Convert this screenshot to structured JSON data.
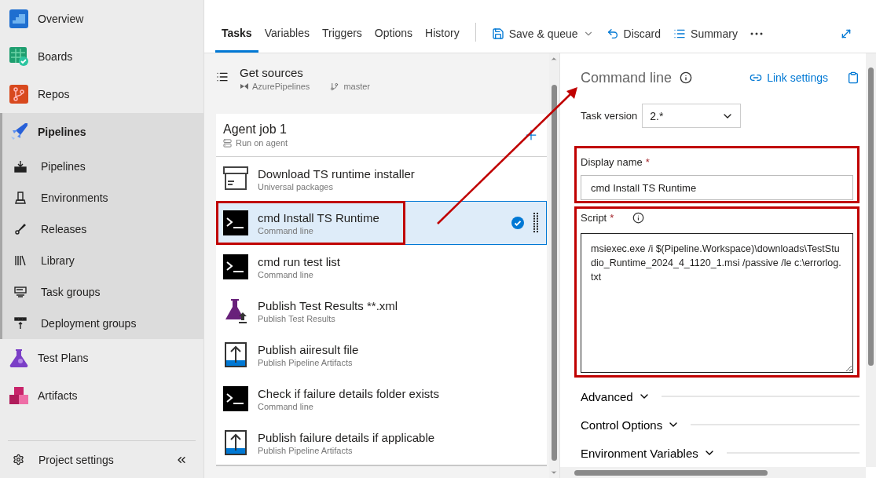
{
  "sidebar": {
    "items": [
      {
        "label": "Overview",
        "selected": false
      },
      {
        "label": "Boards",
        "selected": false
      },
      {
        "label": "Repos",
        "selected": false
      },
      {
        "label": "Pipelines",
        "selected": true,
        "expanded": true,
        "children": [
          {
            "label": "Pipelines"
          },
          {
            "label": "Environments"
          },
          {
            "label": "Releases"
          },
          {
            "label": "Library"
          },
          {
            "label": "Task groups"
          },
          {
            "label": "Deployment groups"
          }
        ]
      },
      {
        "label": "Test Plans",
        "selected": false
      },
      {
        "label": "Artifacts",
        "selected": false
      }
    ],
    "footer": {
      "label": "Project settings"
    }
  },
  "tabs": [
    {
      "label": "Tasks",
      "selected": true
    },
    {
      "label": "Variables",
      "selected": false
    },
    {
      "label": "Triggers",
      "selected": false
    },
    {
      "label": "Options",
      "selected": false
    },
    {
      "label": "History",
      "selected": false
    }
  ],
  "toolbar": [
    {
      "label": "Save & queue",
      "kind": "save"
    },
    {
      "label": "Discard",
      "kind": "discard"
    },
    {
      "label": "Summary",
      "kind": "summary"
    }
  ],
  "get_sources": {
    "title": "Get sources",
    "repo": "AzurePipelines",
    "branch": "master"
  },
  "agent_job": {
    "title": "Agent job 1",
    "subtitle": "Run on agent"
  },
  "tasks": [
    {
      "name": "Download TS runtime installer",
      "type": "Universal packages",
      "kind": "package",
      "selected": false,
      "highlighted": false
    },
    {
      "name": "cmd Install TS Runtime",
      "type": "Command line",
      "kind": "command",
      "selected": true,
      "highlighted": true
    },
    {
      "name": "cmd run test list",
      "type": "Command line",
      "kind": "command",
      "selected": false,
      "highlighted": false
    },
    {
      "name": "Publish Test Results **.xml",
      "type": "Publish Test Results",
      "kind": "test",
      "selected": false,
      "highlighted": false
    },
    {
      "name": "Publish aiiresult file",
      "type": "Publish Pipeline Artifacts",
      "kind": "artifact",
      "selected": false,
      "highlighted": false
    },
    {
      "name": "Check if failure details folder exists",
      "type": "Command line",
      "kind": "command",
      "selected": false,
      "highlighted": false
    },
    {
      "name": "Publish failure details if applicable",
      "type": "Publish Pipeline Artifacts",
      "kind": "artifact",
      "selected": false,
      "highlighted": false
    }
  ],
  "details": {
    "title": "Command line",
    "link": "Link settings",
    "task_version": {
      "label": "Task version",
      "value": "2.*"
    },
    "display_name": {
      "label": "Display name",
      "required_mark": "*",
      "value": "cmd Install TS Runtime",
      "highlighted": true
    },
    "script": {
      "label": "Script",
      "required_mark": "*",
      "value": "msiexec.exe /i $(Pipeline.Workspace)\\downloads\\TestStudio_Runtime_2024_4_1120_1.msi /passive /le c:\\errorlog.txt",
      "highlighted": true
    },
    "sections": [
      {
        "label": "Advanced",
        "expanded": false
      },
      {
        "label": "Control Options",
        "expanded": false
      },
      {
        "label": "Environment Variables",
        "expanded": false
      }
    ]
  }
}
